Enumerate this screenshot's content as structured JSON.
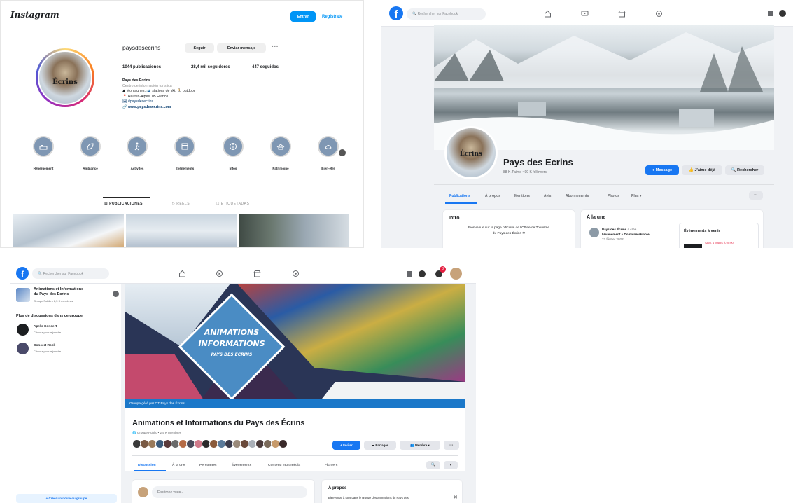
{
  "instagram": {
    "logo": "Instagram",
    "login_label": "Entrar",
    "signup_label": "Regístrate",
    "username": "paysdesecrins",
    "follow_label": "Seguir",
    "message_label": "Enviar mensaje",
    "more_label": "···",
    "avatar_text": "Écrins",
    "stats": {
      "posts": "1044 publicaciones",
      "followers": "28,4 mil seguidores",
      "following": "447 seguidos"
    },
    "bio": {
      "name": "Pays des Écrins",
      "category": "Centro de información turística",
      "line1": "⛰ Montagnes, 🎿 stations de ski, 🏃 outdoor",
      "line2": "📍 Hautes-Alpes, 05 France",
      "line3": "🖼 #paysdesecrins",
      "link": "🔗 www.paysdesecrins.com"
    },
    "highlights": [
      "Hébergement",
      "Ambiance",
      "Activités",
      "Évènements",
      "Infos",
      "Patrimoine",
      "Bien-être"
    ],
    "tabs": [
      "▦ PUBLICACIONES",
      "▷ REELS",
      "☐ ETIQUETADAS"
    ]
  },
  "fb_page": {
    "search_placeholder": "Rechercher sur Facebook",
    "name": "Pays des Ecrins",
    "meta": "88 K J'aime • 99 K followers",
    "avatar_text": "Écrins",
    "message_label": "Message",
    "like_label": "J'aime déjà",
    "search_label": "Rechercher",
    "tabs": [
      "Publications",
      "À propos",
      "Mentions",
      "Avis",
      "Abonnements",
      "Photos",
      "Plus ▾"
    ],
    "more_label": "···",
    "intro_title": "Intro",
    "intro_text1": "Bienvenue sur la page officielle de l'Office de Tourisme",
    "intro_text2": "du Pays des Écrins ❄",
    "featured_title": "À la une",
    "post_author": "Pays des Écrins",
    "post_line1": "a créé",
    "post_line2": "l'évènement « Domaine skiable...",
    "post_date": "22 février 2022",
    "events_title": "Évènements à venir",
    "event_text": "SAM. 4 MARS À 00:00"
  },
  "fb_group": {
    "search_placeholder": "Rechercher sur Facebook",
    "group_name_1": "Animations et Informations",
    "group_name_2": "du Pays des Ecrins",
    "group_meta": "Groupe Public • 2,5 K membres",
    "more_discussions": "Plus de discussions dans ce groupe",
    "discussions": [
      {
        "name": "Après Concert",
        "sub": "Cliquez pour rejoindre"
      },
      {
        "name": "Concert Rock",
        "sub": "Cliquez pour rejoindre"
      }
    ],
    "cover_line1": "ANIMATIONS",
    "cover_line2": "INFORMATIONS",
    "cover_line3": "PAYS DES ÉCRINS",
    "managed_by": "Groupe géré par OT Pays des Écrins",
    "title": "Animations et Informations du Pays des Écrins",
    "meta": "🌐 Groupe Public • 2,5 K membres",
    "invite_label": "+ Inviter",
    "share_label": "Partager",
    "member_label": "Membre ▾",
    "more_label": "···",
    "tabs": [
      "Discussion",
      "À la une",
      "Personnes",
      "Événements",
      "Contenu multimédia",
      "Fichiers"
    ],
    "write_placeholder": "Exprimez-vous...",
    "about_title": "À propos",
    "about_text": "Bienvenue à tous dans le groupe des animations du Pays des",
    "bottom_button": "+ Créer un nouveau groupe",
    "notif_count": "8"
  }
}
